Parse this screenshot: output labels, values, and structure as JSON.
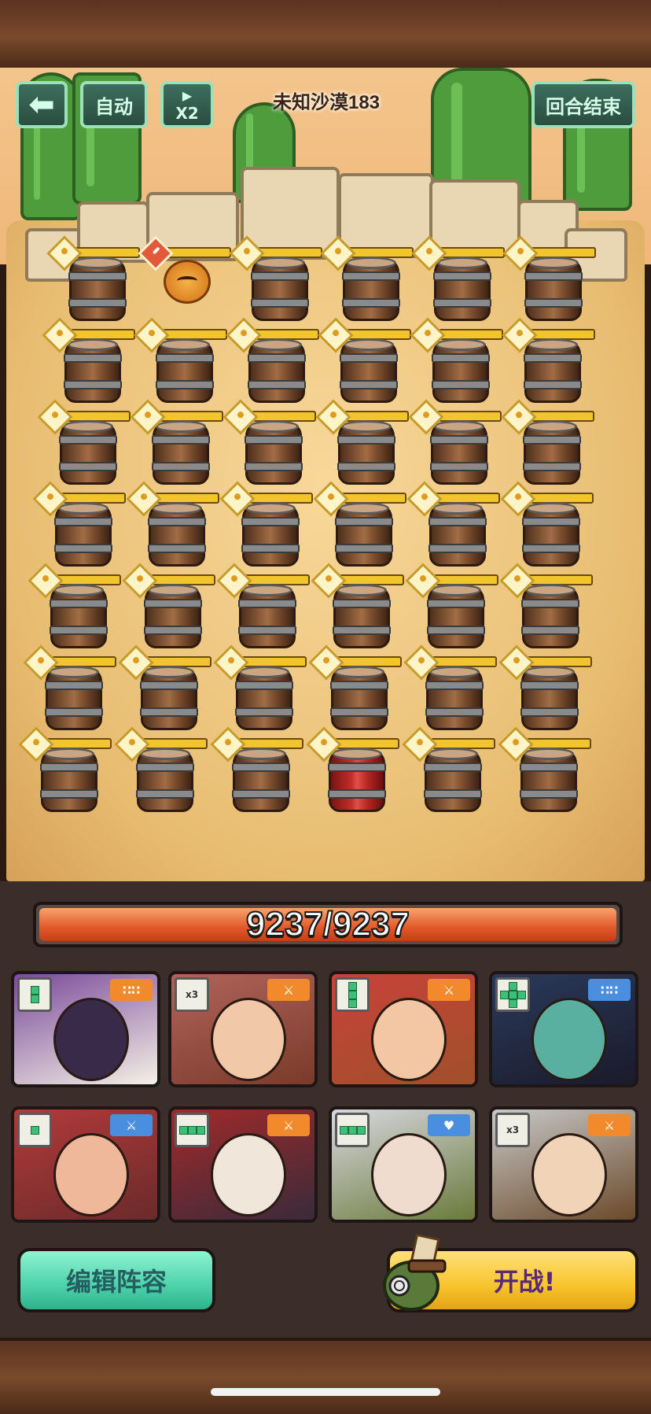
{
  "header": {
    "back_icon": "back-arrow-icon",
    "auto_label": "自动",
    "speed_icon": "play-icon",
    "speed_label": "X2",
    "stage_title": "未知沙漠183",
    "end_turn_label": "回合结束"
  },
  "board": {
    "columns": 6,
    "rows": 7,
    "special_cells": [
      {
        "row": 0,
        "col": 1,
        "kind": "enemy-pumpkin",
        "marker": "alert"
      },
      {
        "row": 6,
        "col": 3,
        "kind": "red-barrel"
      }
    ],
    "default_kind": "barrel"
  },
  "party_hp": {
    "text": "9237/9237",
    "current": 9237,
    "max": 9237
  },
  "heroes": [
    {
      "name": "hero-witch-hat",
      "shape_icon": "two-block-vertical-icon",
      "role_icon": "dots-icon",
      "role_color": "orange"
    },
    {
      "name": "hero-sunglasses",
      "shape_label": "x3",
      "role_icon": "sword-icon",
      "role_color": "orange"
    },
    {
      "name": "hero-pirate",
      "shape_icon": "three-block-vertical-icon",
      "role_icon": "sword-icon",
      "role_color": "orange"
    },
    {
      "name": "hero-hooded-cat",
      "shape_icon": "cross-block-icon",
      "role_icon": "dots-icon",
      "role_color": "blue"
    },
    {
      "name": "hero-red-hood",
      "shape_icon": "single-block-icon",
      "role_icon": "sword-icon",
      "role_color": "blue"
    },
    {
      "name": "hero-straw-hat",
      "shape_icon": "three-block-horizontal-icon",
      "role_icon": "sword-icon",
      "role_color": "orange"
    },
    {
      "name": "hero-white-wolf",
      "shape_icon": "three-block-horizontal-icon",
      "role_icon": "heart-icon",
      "role_color": "blue"
    },
    {
      "name": "hero-white-hair",
      "shape_label": "x3",
      "role_icon": "sword-icon",
      "role_color": "orange"
    }
  ],
  "footer": {
    "edit_label": "编辑阵容",
    "fight_label": "开战!"
  }
}
